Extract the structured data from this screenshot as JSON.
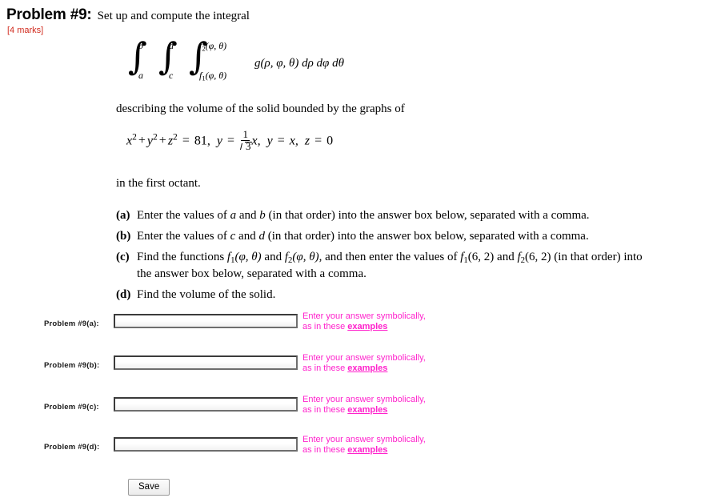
{
  "header": {
    "problem_title": "Problem #9:",
    "stem": "Set up and compute the integral",
    "marks": "[4 marks]"
  },
  "integral": {
    "outer_upper": "b",
    "outer_lower": "a",
    "middle_upper": "d",
    "middle_lower": "c",
    "inner_upper_f": "f",
    "inner_upper_sub": "2",
    "inner_upper_args": "(φ, θ)",
    "inner_lower_f": "f",
    "inner_lower_sub": "1",
    "inner_lower_args": "(φ, θ)",
    "integrand": "g(ρ, φ, θ) dρ dφ dθ"
  },
  "describing_line": "describing the volume of the solid bounded by the graphs of",
  "equation": {
    "x": "x",
    "y": "y",
    "z": "z",
    "sq": "2",
    "plus": "+",
    "equals": "=",
    "rhs_value": "81,",
    "y2": "y",
    "eq2": "=",
    "frac_num": "1",
    "frac_den": "3",
    "x_after_frac": "x,",
    "y3": "y",
    "eq3": "=",
    "x3": "x,",
    "z2": "z",
    "eq4": "=",
    "zero": "0"
  },
  "octant_line": "in the first octant.",
  "items": [
    {
      "marker": "(a)",
      "text_parts": [
        "Enter the values of ",
        "a",
        " and ",
        "b",
        " (in that order) into the answer box below, separated with a comma."
      ]
    },
    {
      "marker": "(b)",
      "text_parts": [
        "Enter the values of ",
        "c",
        " and ",
        "d",
        " (in that order) into the answer box below, separated with a comma."
      ]
    },
    {
      "marker": "(c)",
      "text": "Find the functions f₁(φ, θ) and f₂(φ, θ), and then enter the values of f₁(6, 2) and f₂(6, 2) (in that order) into the answer box below, separated with a comma."
    },
    {
      "marker": "(d)",
      "text": "Find the volume of the solid."
    }
  ],
  "item_c": {
    "marker": "(c)",
    "lead": "Find the functions ",
    "f": "f",
    "sub1": "1",
    "sub2": "2",
    "args": "(φ, θ)",
    "and": " and ",
    "mid": ", and then enter the values of ",
    "args_num": "(6, 2)",
    "tail": " (in that order) into",
    "line2": "the answer box below, separated with a comma."
  },
  "item_d": {
    "marker": "(d)",
    "text": "Find the volume of the solid."
  },
  "answers": [
    {
      "label": "Problem #9(a):",
      "value": "",
      "placeholder": "",
      "hint_line1": "Enter your answer symbolically,",
      "hint_line2_prefix": "as in these ",
      "hint_link": "examples"
    },
    {
      "label": "Problem #9(b):",
      "value": "",
      "placeholder": "",
      "hint_line1": "Enter your answer symbolically,",
      "hint_line2_prefix": "as in these ",
      "hint_link": "examples"
    },
    {
      "label": "Problem #9(c):",
      "value": "",
      "placeholder": "",
      "hint_line1": "Enter your answer symbolically,",
      "hint_line2_prefix": "as in these ",
      "hint_link": "examples"
    },
    {
      "label": "Problem #9(d):",
      "value": "",
      "placeholder": "",
      "hint_line1": "Enter your answer symbolically,",
      "hint_line2_prefix": "as in these ",
      "hint_link": "examples"
    }
  ],
  "save_button": "Save",
  "colors": {
    "marks_red": "#d12b1e",
    "hint_magenta": "#ff22cc",
    "text_black": "#000000",
    "page_background": "#ffffff"
  }
}
